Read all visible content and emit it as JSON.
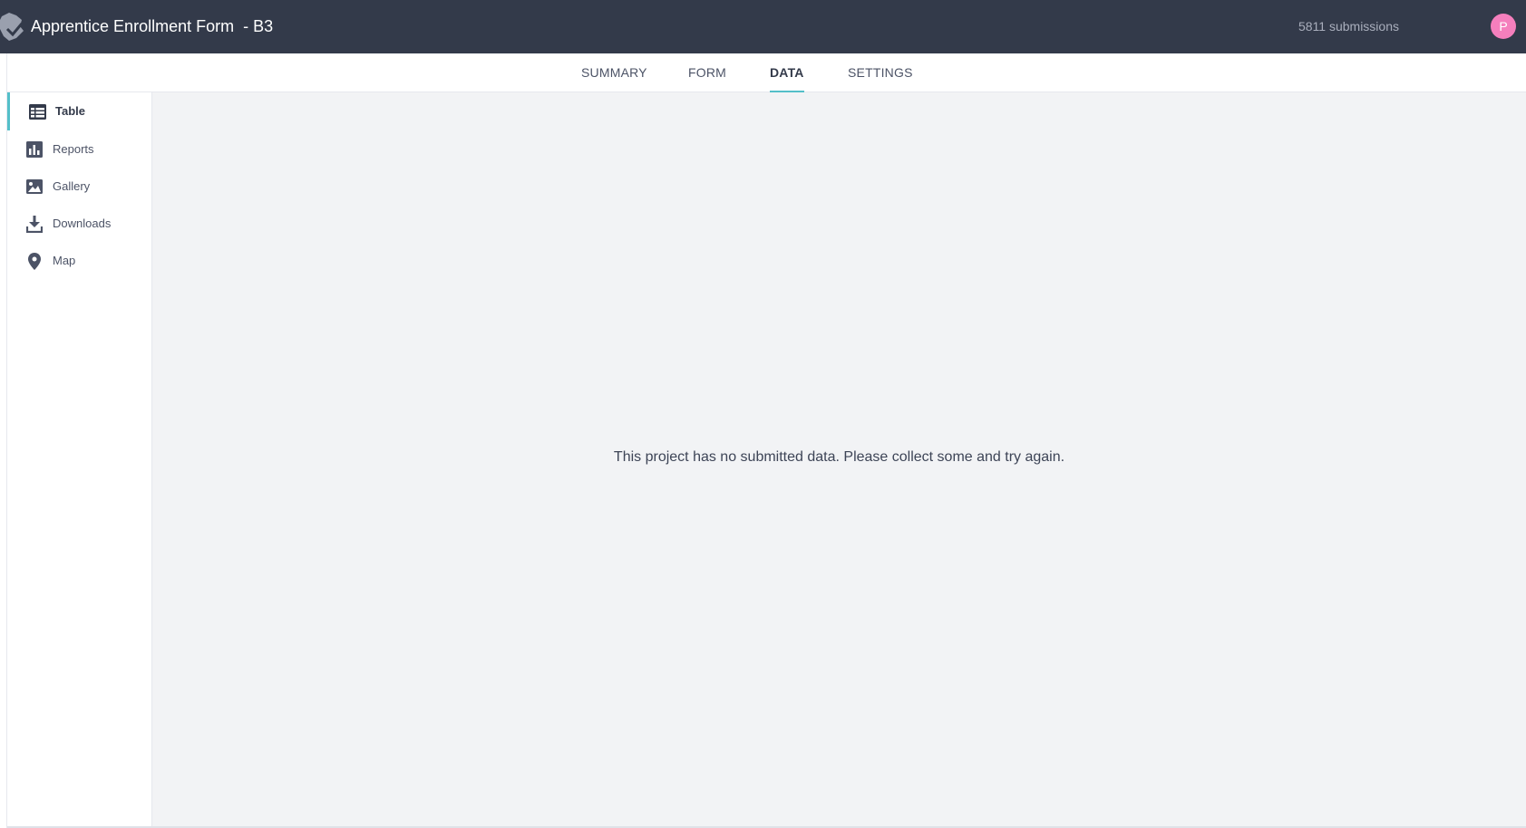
{
  "header": {
    "title": "Apprentice Enrollment Form  - B3",
    "submissions": "5811 submissions",
    "avatar_initial": "P",
    "logo_icon": "kobo-logo-icon",
    "background": "#333a4a",
    "avatar_color": "#f57fbd"
  },
  "tabs": [
    {
      "label": "SUMMARY",
      "active": false
    },
    {
      "label": "FORM",
      "active": false
    },
    {
      "label": "DATA",
      "active": true
    },
    {
      "label": "SETTINGS",
      "active": false
    }
  ],
  "sidebar": {
    "items": [
      {
        "label": "Table",
        "icon": "table-icon",
        "active": true
      },
      {
        "label": "Reports",
        "icon": "bar-chart-icon",
        "active": false
      },
      {
        "label": "Gallery",
        "icon": "image-icon",
        "active": false
      },
      {
        "label": "Downloads",
        "icon": "download-icon",
        "active": false
      },
      {
        "label": "Map",
        "icon": "map-pin-icon",
        "active": false
      }
    ]
  },
  "main": {
    "empty_message": "This project has no submitted data. Please collect some and try again."
  },
  "colors": {
    "accent": "#54bfc9",
    "content_background": "#f2f3f5"
  }
}
